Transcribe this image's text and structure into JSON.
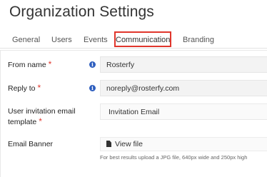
{
  "page": {
    "title": "Organization Settings"
  },
  "tabs": [
    {
      "label": "General"
    },
    {
      "label": "Users"
    },
    {
      "label": "Events"
    },
    {
      "label": "Communication",
      "active": true
    },
    {
      "label": "Branding"
    }
  ],
  "form": {
    "from_name": {
      "label": "From name",
      "required": "*",
      "value": "Rosterfy"
    },
    "reply_to": {
      "label": "Reply to",
      "required": "*",
      "value": "noreply@rosterfy.com"
    },
    "invitation_template": {
      "label_line1": "User invitation email",
      "label_line2": "template",
      "required": "*",
      "value": "Invitation Email"
    },
    "email_banner": {
      "label": "Email Banner",
      "button_label": "View file",
      "hint": "For best results upload a JPG file, 640px wide and 250px high"
    }
  },
  "icons": {
    "info": "info-icon",
    "file": "file-icon"
  },
  "colors": {
    "accent": "#e0362c",
    "info": "#2f5fbf"
  }
}
